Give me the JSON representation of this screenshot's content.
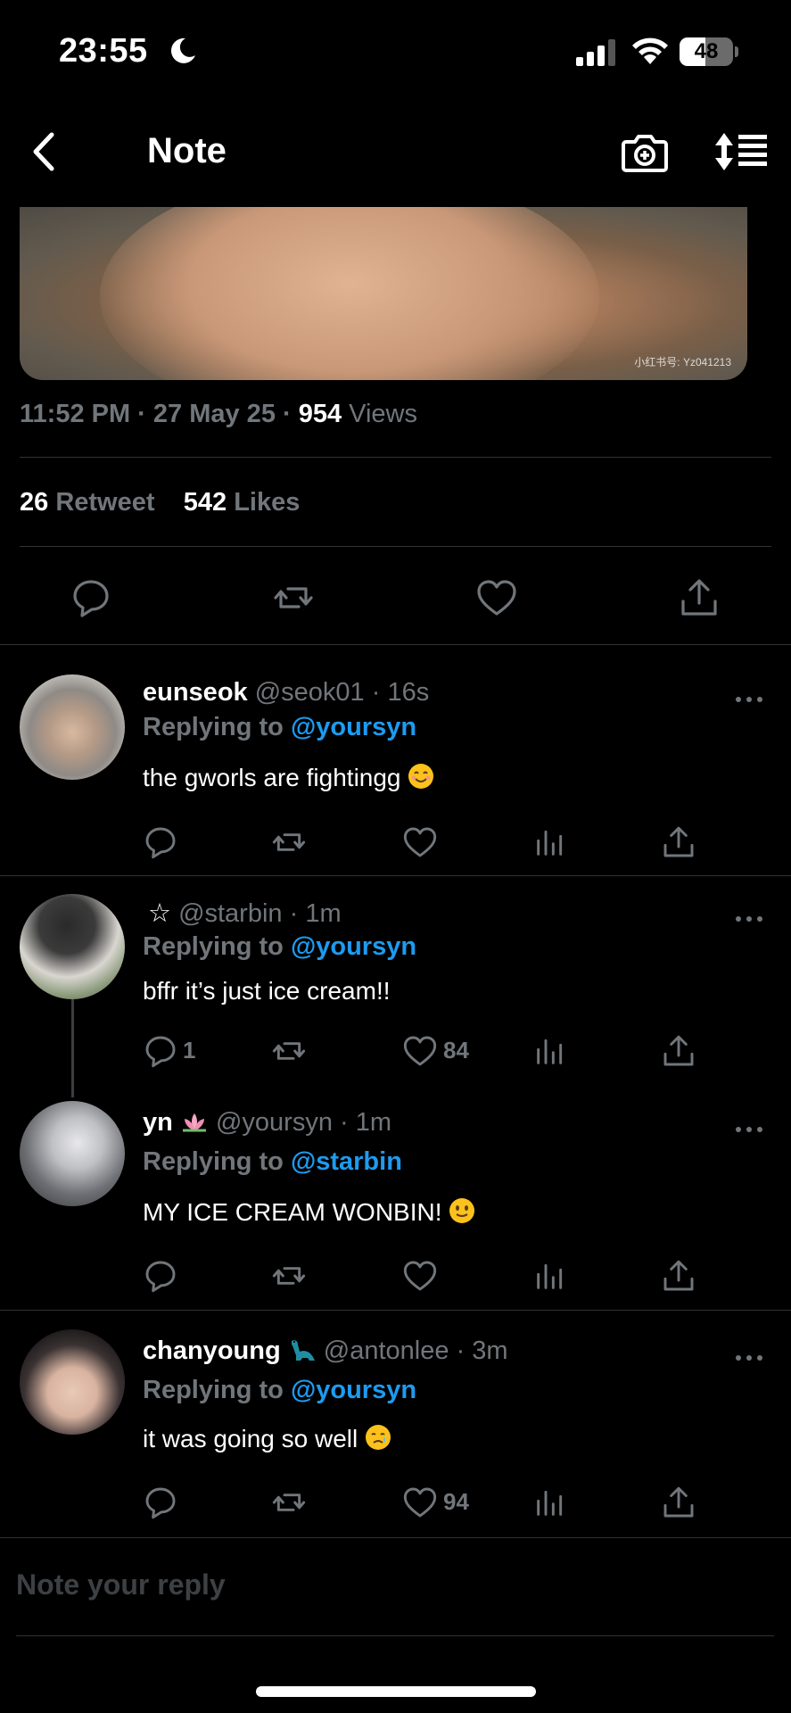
{
  "status": {
    "time": "23:55",
    "battery": "48",
    "battery_level": 0.48
  },
  "nav": {
    "title": "Note"
  },
  "media": {
    "watermark": "小红书号: Yz041213"
  },
  "tweet": {
    "time": "11:52 PM · 27 May 25 · ",
    "views_count": "954",
    "views_label": "Views",
    "retweets_count": "26",
    "retweets_label": "Retweet",
    "likes_count": "542",
    "likes_label": "Likes"
  },
  "replies": [
    {
      "display_name": "eunseok",
      "handle": "@seok01 · 16s",
      "replying_prefix": "Replying to ",
      "replying_to": "@yoursyn",
      "text": "the gworls are fightingg",
      "emoji": "blush-emoji",
      "reply_count": "",
      "like_count": ""
    },
    {
      "display_name": "☆",
      "handle": "@starbin · 1m",
      "replying_prefix": "Replying to ",
      "replying_to": "@yoursyn",
      "text": "bffr it’s just ice cream!!",
      "reply_count": "1",
      "like_count": "84"
    },
    {
      "display_name": "yn",
      "name_emoji": "lotus-emoji",
      "handle": "@yoursyn · 1m",
      "replying_prefix": "Replying to ",
      "replying_to": "@starbin",
      "text": "MY ICE CREAM WONBIN!",
      "emoji": "slight-smile-emoji",
      "reply_count": "",
      "like_count": ""
    },
    {
      "display_name": "chanyoung",
      "name_emoji": "dinosaur-emoji",
      "handle": "@antonlee · 3m",
      "replying_prefix": "Replying to ",
      "replying_to": "@yoursyn",
      "text": "it was going so well",
      "emoji": "sad-tear-emoji",
      "reply_count": "",
      "like_count": "94"
    }
  ],
  "composer": {
    "placeholder": "Note your reply"
  },
  "colors": {
    "background": "#000000",
    "muted": "#71767b",
    "accent": "#1d9bf0",
    "divider": "#2f3336"
  }
}
